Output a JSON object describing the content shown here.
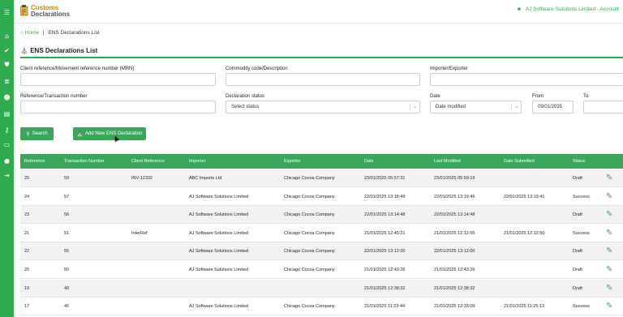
{
  "app": {
    "logo_line1": "Customs",
    "logo_line2": "Declarations",
    "account_label": "AJ Software Solutions Limited - Account"
  },
  "sidebar": {
    "items": [
      {
        "icon": "menu-icon",
        "glyph": "☰"
      },
      {
        "icon": "home-icon",
        "glyph": "⌂"
      },
      {
        "icon": "check-icon",
        "glyph": "✔"
      },
      {
        "icon": "shield-icon",
        "glyph": "⛊"
      },
      {
        "icon": "list-icon",
        "glyph": "≣"
      },
      {
        "icon": "users-icon",
        "glyph": "☻"
      },
      {
        "icon": "document-icon",
        "glyph": "▤"
      },
      {
        "icon": "key-icon",
        "glyph": "⚷"
      },
      {
        "icon": "id-card-icon",
        "glyph": "▭"
      },
      {
        "icon": "user-icon",
        "glyph": "●"
      },
      {
        "icon": "sign-out-icon",
        "glyph": "⇥"
      }
    ]
  },
  "breadcrumb": {
    "home": "Home",
    "separator": "|",
    "current": "ENS Declarations List"
  },
  "page_title": "ENS Declarations List",
  "filters": {
    "client_ref_label": "Client reference/Movement reference number (MRN)",
    "client_ref_value": "",
    "commodity_label": "Commodity code/Description",
    "commodity_value": "",
    "importer_label": "Importer/Exporter",
    "importer_value": "",
    "reference_label": "Reference/Transaction number",
    "reference_value": "",
    "status_label": "Declaration status",
    "status_value": "Select status",
    "date_label": "Date",
    "date_value": "Date modified",
    "from_label": "From",
    "from_value": "09/01/2025",
    "to_label": "To",
    "to_value": ""
  },
  "actions": {
    "search_label": "Search",
    "add_label": "Add New ENS Declaration"
  },
  "table": {
    "headers": [
      "Reference",
      "Transaction Number",
      "Client Reference",
      "Importer",
      "Exporter",
      "Date",
      "Last Modified",
      "Date Submitted",
      "Status"
    ],
    "rows": [
      [
        "25",
        "59",
        "INV-12332",
        "ABC Imports Ltd",
        "Chicago Cocoa Company",
        "23/01/2025 05:57:31",
        "23/01/2025 05:59:19",
        "",
        "Draft"
      ],
      [
        "24",
        "57",
        "",
        "AJ Software Solutions Limited",
        "Chicago Cocoa Company",
        "22/01/2025 13:18:49",
        "22/01/2025 13:19:46",
        "22/01/2025 13:19:41",
        "Success"
      ],
      [
        "23",
        "56",
        "",
        "AJ Software Solutions Limited",
        "Chicago Cocoa Company",
        "22/01/2025 13:14:48",
        "22/01/2025 13:14:48",
        "",
        "Draft"
      ],
      [
        "21",
        "51",
        "InterRef",
        "AJ Software Solutions Limited",
        "Chicago Cocoa Company",
        "21/01/2025 12:45:21",
        "21/01/2025 12:12:55",
        "21/01/2025 12:12:50",
        "Success"
      ],
      [
        "22",
        "55",
        "",
        "AJ Software Solutions Limited",
        "Chicago Cocoa Company",
        "22/01/2025 13:12:00",
        "22/01/2025 13:12:00",
        "",
        "Draft"
      ],
      [
        "20",
        "50",
        "",
        "AJ Software Solutions Limited",
        "Chicago Cocoa Company",
        "21/01/2025 12:43:26",
        "21/01/2025 12:43:26",
        "",
        "Draft"
      ],
      [
        "19",
        "49",
        "",
        "",
        "",
        "21/01/2025 12:38:32",
        "21/01/2025 12:38:32",
        "",
        "Draft"
      ],
      [
        "17",
        "46",
        "",
        "AJ Software Solutions Limited",
        "Chicago Cocoa Company",
        "21/01/2025 11:23:44",
        "21/01/2025 12:33:09",
        "21/01/2025 11:25:13",
        "Success"
      ]
    ]
  },
  "colors": {
    "accent": "#2eab4d",
    "button": "#3aa65a",
    "row_alt": "#f2f2f2"
  }
}
